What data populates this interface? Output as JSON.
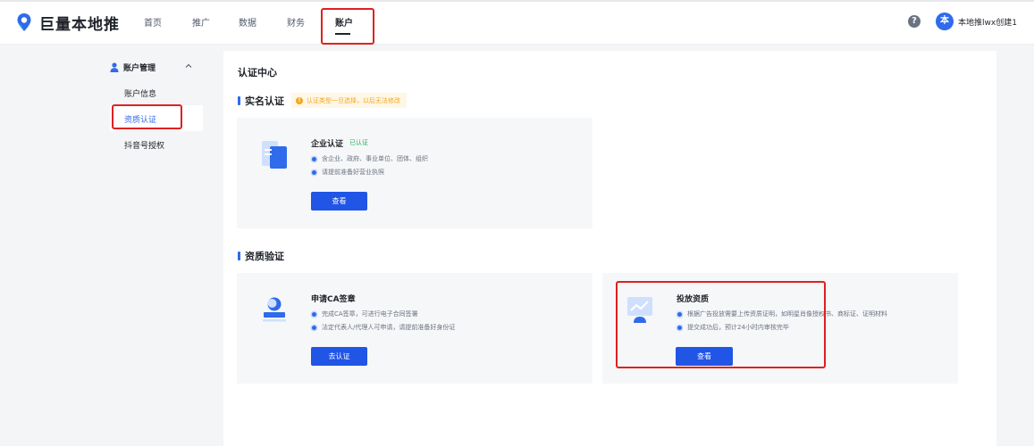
{
  "brand": {
    "name": "巨量本地推"
  },
  "nav": {
    "items": [
      "首页",
      "推广",
      "数据",
      "财务",
      "账户"
    ],
    "active": "账户"
  },
  "header": {
    "help_glyph": "?",
    "avatar_text": "本",
    "username": "本地推lwx创建1"
  },
  "sidebar": {
    "group_label": "账户管理",
    "items": [
      "账户信息",
      "资质认证",
      "抖音号授权"
    ],
    "active": "资质认证"
  },
  "page": {
    "title": "认证中心"
  },
  "realname": {
    "title": "实名认证",
    "notice": "认证类型一旦选择，以后无法修改",
    "card": {
      "title": "企业认证",
      "badge": "已认证",
      "bullets": [
        "含企业、政府、事业单位、团体、组织",
        "请提前准备好营业执照"
      ],
      "button": "查看"
    }
  },
  "qualification": {
    "title": "资质验证",
    "cards": [
      {
        "title": "申请CA签章",
        "bullets": [
          "完成CA签章，可进行电子合同签署",
          "法定代表人/代理人可申请，请提前准备好身份证"
        ],
        "button": "去认证"
      },
      {
        "title": "投放资质",
        "bullets": [
          "根据广告投放需要上传资质证明，如明星肖像授权书、商标证、证明材料",
          "提交成功后，预计24小时内审核完毕"
        ],
        "button": "查看"
      }
    ]
  },
  "colors": {
    "accent": "#2155e6",
    "highlight": "#e02020",
    "success": "#21b15a",
    "warning": "#f5a623"
  }
}
